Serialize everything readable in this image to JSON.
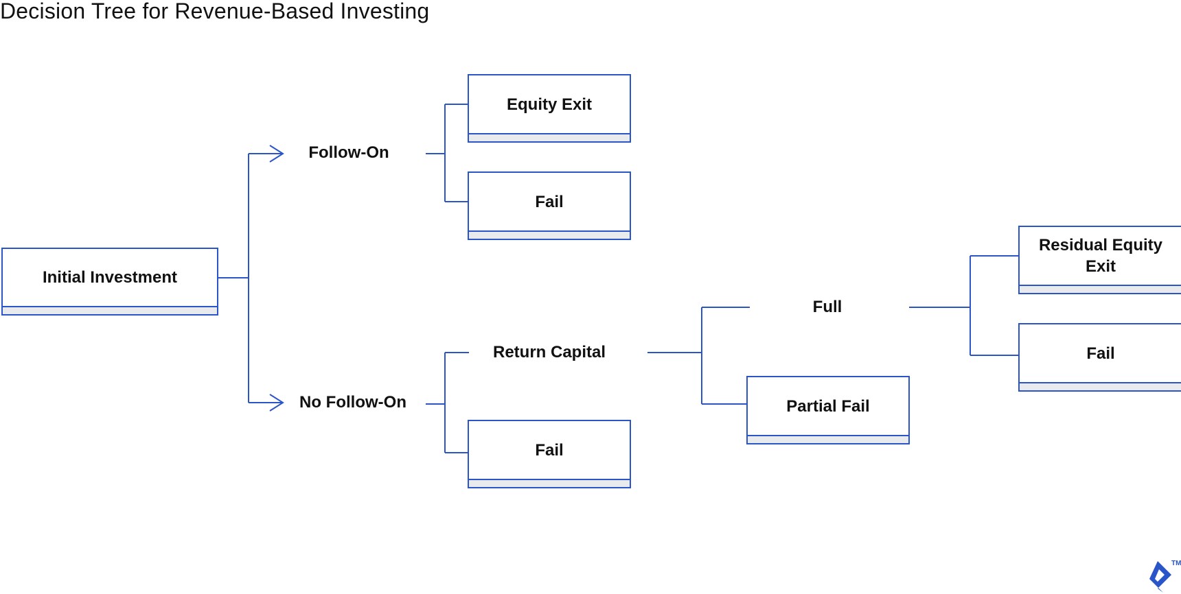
{
  "title": "Decision Tree for Revenue-Based Investing",
  "colors": {
    "line": "#2a55c9",
    "band": "#e9eaee",
    "text": "#111111",
    "background": "#ffffff"
  },
  "nodes": {
    "initial_investment": "Initial Investment",
    "follow_on": "Follow-On",
    "no_follow_on": "No Follow-On",
    "equity_exit": "Equity Exit",
    "fail_follow_on": "Fail",
    "return_capital": "Return Capital",
    "fail_no_follow_on": "Fail",
    "full": "Full",
    "partial_fail": "Partial Fail",
    "residual_equity_exit": "Residual Equity Exit",
    "fail_full": "Fail"
  },
  "edges": [
    [
      "Initial Investment",
      "Follow-On"
    ],
    [
      "Initial Investment",
      "No Follow-On"
    ],
    [
      "Follow-On",
      "Equity Exit"
    ],
    [
      "Follow-On",
      "Fail"
    ],
    [
      "No Follow-On",
      "Return Capital"
    ],
    [
      "No Follow-On",
      "Fail"
    ],
    [
      "Return Capital",
      "Full"
    ],
    [
      "Return Capital",
      "Partial Fail"
    ],
    [
      "Full",
      "Residual Equity Exit"
    ],
    [
      "Full",
      "Fail"
    ]
  ],
  "logo": {
    "name": "toptal-logo",
    "trademark": "TM"
  }
}
